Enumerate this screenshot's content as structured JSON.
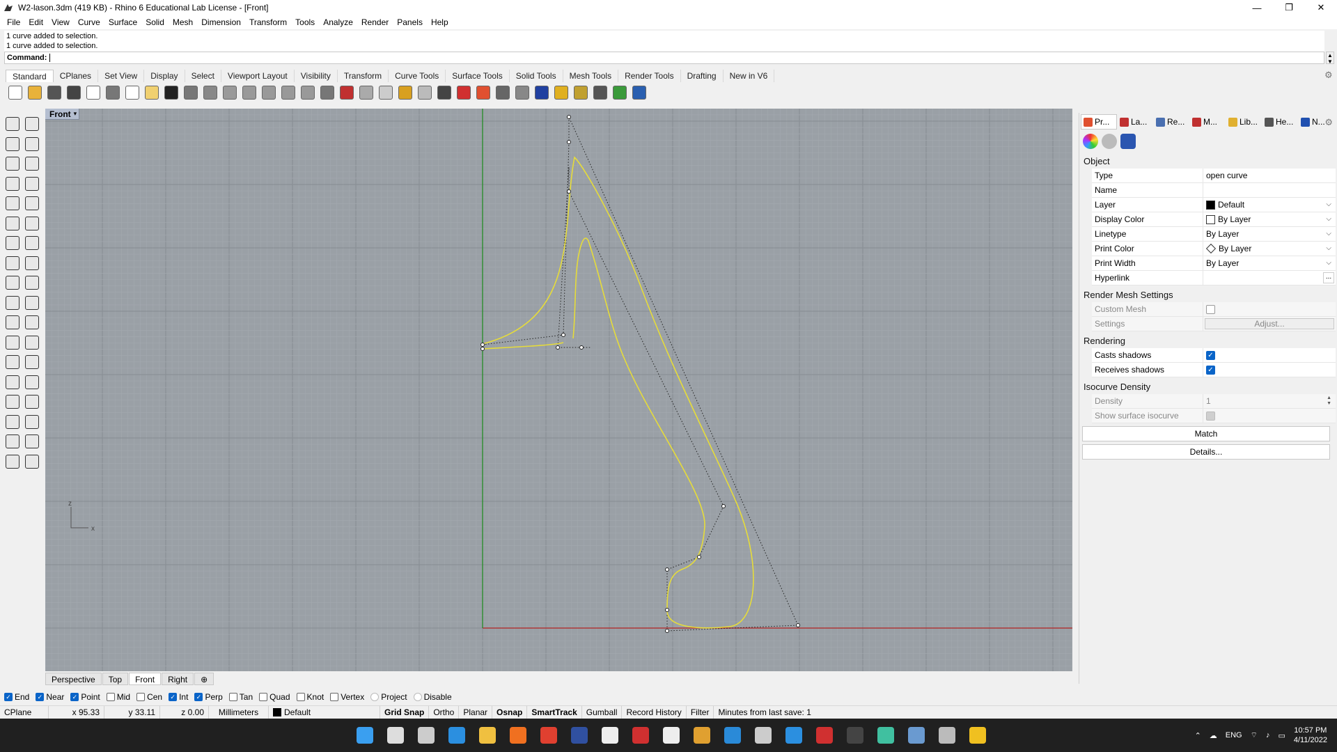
{
  "window": {
    "title": "W2-lason.3dm (419 KB) - Rhino 6 Educational Lab License - [Front]",
    "min": "—",
    "max": "❐",
    "close": "✕"
  },
  "menu": [
    "File",
    "Edit",
    "View",
    "Curve",
    "Surface",
    "Solid",
    "Mesh",
    "Dimension",
    "Transform",
    "Tools",
    "Analyze",
    "Render",
    "Panels",
    "Help"
  ],
  "command": {
    "history": [
      "1 curve added to selection.",
      "1 curve added to selection."
    ],
    "label": "Command:"
  },
  "toolbar_tabs": [
    "Standard",
    "CPlanes",
    "Set View",
    "Display",
    "Select",
    "Viewport Layout",
    "Visibility",
    "Transform",
    "Curve Tools",
    "Surface Tools",
    "Solid Tools",
    "Mesh Tools",
    "Render Tools",
    "Drafting",
    "New in V6"
  ],
  "toolbar_icons": [
    {
      "name": "new-icon",
      "color": "#ffffff"
    },
    {
      "name": "open-icon",
      "color": "#e8b23a"
    },
    {
      "name": "save-icon",
      "color": "#555555"
    },
    {
      "name": "print-icon",
      "color": "#444444"
    },
    {
      "name": "export-icon",
      "color": "#ffffff"
    },
    {
      "name": "cut-icon",
      "color": "#777777"
    },
    {
      "name": "copy-icon",
      "color": "#ffffff"
    },
    {
      "name": "paste-icon",
      "color": "#f0d070"
    },
    {
      "name": "undo-icon",
      "color": "#222222"
    },
    {
      "name": "pan-icon",
      "color": "#777777"
    },
    {
      "name": "rotate-view-icon",
      "color": "#888888"
    },
    {
      "name": "zoom-icon",
      "color": "#999999"
    },
    {
      "name": "zoom-window-icon",
      "color": "#999999"
    },
    {
      "name": "zoom-extents-icon",
      "color": "#999999"
    },
    {
      "name": "zoom-selected-icon",
      "color": "#999999"
    },
    {
      "name": "undo-view-icon",
      "color": "#999999"
    },
    {
      "name": "four-viewports-icon",
      "color": "#777777"
    },
    {
      "name": "car-icon",
      "color": "#c03030"
    },
    {
      "name": "airplane-icon",
      "color": "#aaaaaa"
    },
    {
      "name": "target-icon",
      "color": "#cccccc"
    },
    {
      "name": "snap-icon",
      "color": "#d8a020"
    },
    {
      "name": "light-bulb-icon",
      "color": "#bbbbbb"
    },
    {
      "name": "lock-icon",
      "color": "#444444"
    },
    {
      "name": "material-icon",
      "color": "#d03030"
    },
    {
      "name": "color-wheel-icon",
      "color": "#e05030"
    },
    {
      "name": "shaded-sphere-icon",
      "color": "#666666"
    },
    {
      "name": "render-sphere-icon",
      "color": "#888888"
    },
    {
      "name": "blue-sphere-icon",
      "color": "#2040a0"
    },
    {
      "name": "flag-icon",
      "color": "#e0b020"
    },
    {
      "name": "options-gear-icon",
      "color": "#c0a030"
    },
    {
      "name": "grid-options-icon",
      "color": "#555555"
    },
    {
      "name": "globe-icon",
      "color": "#3a9a3a"
    },
    {
      "name": "help-icon",
      "color": "#2a5fb0"
    }
  ],
  "left_tools": [
    [
      "select-arrow-icon",
      "point-icon"
    ],
    [
      "polyline-icon",
      "curve-cv-icon"
    ],
    [
      "circle-icon",
      "ellipse-icon"
    ],
    [
      "polygon-icon",
      "rectangle-icon"
    ],
    [
      "arc-icon",
      "fillet-curve-icon"
    ],
    [
      "surface-icon",
      "loft-icon"
    ],
    [
      "box-solid-icon",
      "boolean-icon"
    ],
    [
      "cylinder-icon",
      "extrude-surface-icon"
    ],
    [
      "explode-icon",
      "join-icon"
    ],
    [
      "trim-icon",
      "split-icon"
    ],
    [
      "group-icon",
      "point-cloud-icon"
    ],
    [
      "offset-curve-icon",
      "blend-curve-icon"
    ],
    [
      "text-icon",
      "scale-icon"
    ],
    [
      "array-icon",
      "mirror-icon"
    ],
    [
      "mesh-icon",
      "dimension-icon"
    ],
    [
      "grid-array-icon",
      "analyze-icon"
    ],
    [
      "render-icon",
      "check-icon"
    ],
    [
      "shade-icon",
      "light-icon"
    ]
  ],
  "viewport": {
    "title": "Front",
    "dropdown": "▾",
    "axis_y": "z",
    "axis_x": "x"
  },
  "viewport_tabs": [
    "Perspective",
    "Top",
    "Front",
    "Right",
    "⊕"
  ],
  "panel": {
    "tabs": [
      {
        "label": "Pr...",
        "icon": "properties-icon",
        "color": "#e05030"
      },
      {
        "label": "La...",
        "icon": "layers-icon",
        "color": "#c03030"
      },
      {
        "label": "Re...",
        "icon": "render-icon",
        "color": "#4a6fb0"
      },
      {
        "label": "M...",
        "icon": "materials-icon",
        "color": "#c03030"
      },
      {
        "label": "Lib...",
        "icon": "libraries-icon",
        "color": "#e0b030"
      },
      {
        "label": "He...",
        "icon": "help-icon",
        "color": "#555555"
      },
      {
        "label": "N...",
        "icon": "notes-icon",
        "color": "#2050b0"
      }
    ],
    "object_section": "Object",
    "type_k": "Type",
    "type_v": "open curve",
    "name_k": "Name",
    "name_v": "",
    "layer_k": "Layer",
    "layer_v": "Default",
    "display_color_k": "Display Color",
    "display_color_v": "By Layer",
    "linetype_k": "Linetype",
    "linetype_v": "By Layer",
    "print_color_k": "Print Color",
    "print_color_v": "By Layer",
    "print_width_k": "Print Width",
    "print_width_v": "By Layer",
    "hyperlink_k": "Hyperlink",
    "hyperlink_v": "",
    "hyperlink_btn": "...",
    "render_mesh_section": "Render Mesh Settings",
    "custom_mesh_k": "Custom Mesh",
    "settings_k": "Settings",
    "adjust_btn": "Adjust...",
    "rendering_section": "Rendering",
    "casts_shadows_k": "Casts shadows",
    "receives_shadows_k": "Receives shadows",
    "isocurve_section": "Isocurve Density",
    "density_k": "Density",
    "density_v": "1",
    "show_iso_k": "Show surface isocurve",
    "match_btn": "Match",
    "details_btn": "Details..."
  },
  "osnaps": [
    {
      "label": "End",
      "checked": true
    },
    {
      "label": "Near",
      "checked": true
    },
    {
      "label": "Point",
      "checked": true
    },
    {
      "label": "Mid",
      "checked": false
    },
    {
      "label": "Cen",
      "checked": false
    },
    {
      "label": "Int",
      "checked": true
    },
    {
      "label": "Perp",
      "checked": true
    },
    {
      "label": "Tan",
      "checked": false
    },
    {
      "label": "Quad",
      "checked": false
    },
    {
      "label": "Knot",
      "checked": false
    },
    {
      "label": "Vertex",
      "checked": false
    },
    {
      "label": "Project",
      "checked": false
    },
    {
      "label": "Disable",
      "checked": false
    }
  ],
  "status": {
    "cplane": "CPlane",
    "x": "x 95.33",
    "y": "y 33.11",
    "z": "z 0.00",
    "units": "Millimeters",
    "layer": "Default",
    "grid_snap": "Grid Snap",
    "ortho": "Ortho",
    "planar": "Planar",
    "osnap": "Osnap",
    "smarttrack": "SmartTrack",
    "gumball": "Gumball",
    "record_history": "Record History",
    "filter": "Filter",
    "last_save": "Minutes from last save: 1"
  },
  "taskbar": {
    "language": "ENG",
    "time": "10:57 PM",
    "date": "4/11/2022",
    "icons": [
      {
        "name": "windows-start-icon",
        "color": "#3a9ff0"
      },
      {
        "name": "search-icon",
        "color": "#dddddd"
      },
      {
        "name": "task-view-icon",
        "color": "#cccccc"
      },
      {
        "name": "mail-icon",
        "color": "#2b8fe0"
      },
      {
        "name": "file-explorer-icon",
        "color": "#f0c040"
      },
      {
        "name": "firefox-icon",
        "color": "#f07020"
      },
      {
        "name": "chrome-icon",
        "color": "#e04030"
      },
      {
        "name": "cinema4d-icon",
        "color": "#3050a0"
      },
      {
        "name": "unreal-icon",
        "color": "#eeeeee"
      },
      {
        "name": "acrobat-icon",
        "color": "#d03030"
      },
      {
        "name": "blender-icon",
        "color": "#eeeeee"
      },
      {
        "name": "git-icon",
        "color": "#e0a030"
      },
      {
        "name": "vscode-icon",
        "color": "#2a8ad8"
      },
      {
        "name": "rhino-icon",
        "color": "#cccccc"
      },
      {
        "name": "store-icon",
        "color": "#2b8fe0"
      },
      {
        "name": "game-icon",
        "color": "#d03030"
      },
      {
        "name": "epic-games-icon",
        "color": "#444444"
      },
      {
        "name": "slack-icon",
        "color": "#40c0a0"
      },
      {
        "name": "photos-icon",
        "color": "#6a9ad0"
      },
      {
        "name": "rhino-active-icon",
        "color": "#bbbbbb"
      },
      {
        "name": "notes-app-icon",
        "color": "#f0c020"
      }
    ]
  },
  "colors": {
    "curve": "#e6dc3a",
    "grid_minor": "#a3a9af",
    "grid_major": "#878d93",
    "axis_x": "#b22222",
    "axis_y": "#1a8a1a",
    "accent": "#0a64c8"
  }
}
